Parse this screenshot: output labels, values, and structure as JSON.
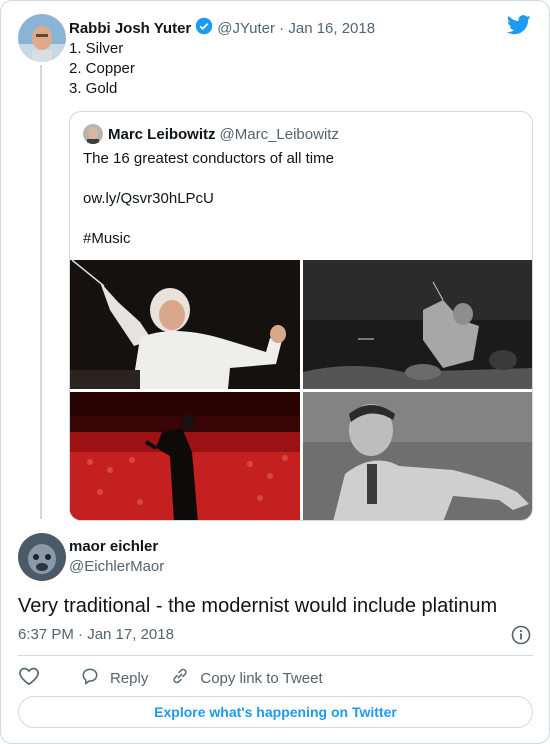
{
  "tweet": {
    "author_name": "Rabbi Josh Yuter",
    "handle_date": "@JYuter · Jan 16, 2018",
    "lines": [
      "1. Silver",
      "2. Copper",
      "3. Gold"
    ]
  },
  "quote": {
    "author_name": "Marc Leibowitz",
    "handle": "@Marc_Leibowitz",
    "line1": "The 16 greatest conductors of all time",
    "line2": "ow.ly/Qsvr30hLPcU",
    "line3": "#Music"
  },
  "reply": {
    "name": "maor eichler",
    "handle": "@EichlerMaor",
    "text": "Very traditional - the modernist would include platinum",
    "timestamp": "6:37 PM · Jan 17, 2018"
  },
  "actions": {
    "reply_label": "Reply",
    "copy_label": "Copy link to Tweet"
  },
  "explore_label": "Explore what's happening on Twitter",
  "colors": {
    "accent": "#1d9bf0",
    "muted": "#536471",
    "border": "#cfd9de"
  },
  "icons": [
    "verified-badge-icon",
    "twitter-bird-icon",
    "info-icon",
    "heart-icon",
    "reply-icon",
    "link-icon"
  ]
}
